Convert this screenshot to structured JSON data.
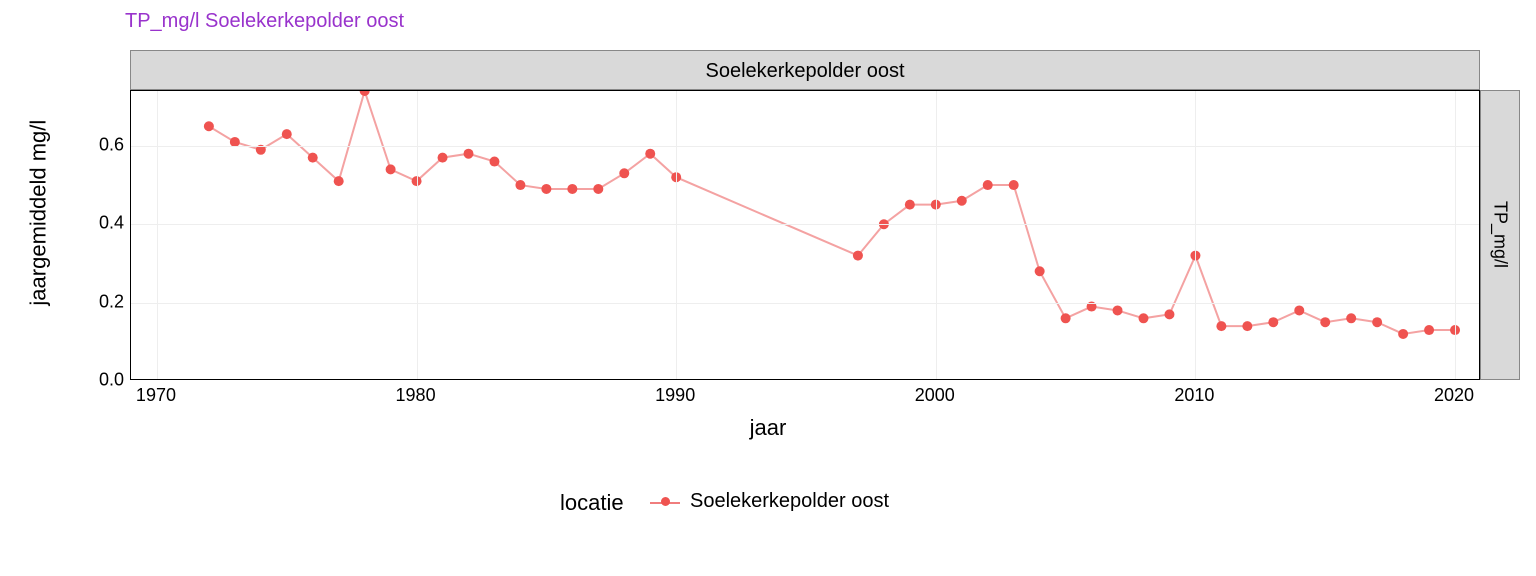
{
  "title": "TP_mg/l Soelekerkepolder oost",
  "facet_top": "Soelekerkepolder oost",
  "facet_right": "TP_mg/l",
  "xlabel": "jaar",
  "ylabel": "jaargemiddeld\nmg/l",
  "legend_title": "locatie",
  "legend_item": "Soelekerkepolder oost",
  "y_ticks": [
    0.0,
    0.2,
    0.4,
    0.6
  ],
  "x_ticks": [
    1970,
    1980,
    1990,
    2000,
    2010,
    2020
  ],
  "chart_data": {
    "type": "line",
    "title": "TP_mg/l Soelekerkepolder oost",
    "xlabel": "jaar",
    "ylabel": "jaargemiddeld mg/l",
    "xlim": [
      1969,
      2021
    ],
    "ylim": [
      0.0,
      0.74
    ],
    "series": [
      {
        "name": "Soelekerkepolder oost",
        "color": "#ef5350",
        "x": [
          1972,
          1973,
          1974,
          1975,
          1976,
          1977,
          1978,
          1979,
          1980,
          1981,
          1982,
          1983,
          1984,
          1985,
          1986,
          1987,
          1988,
          1989,
          1990,
          1997,
          1998,
          1999,
          2000,
          2001,
          2002,
          2003,
          2004,
          2005,
          2006,
          2007,
          2008,
          2009,
          2010,
          2011,
          2012,
          2013,
          2014,
          2015,
          2016,
          2017,
          2018,
          2019,
          2020
        ],
        "y": [
          0.65,
          0.61,
          0.59,
          0.63,
          0.57,
          0.51,
          0.74,
          0.54,
          0.51,
          0.57,
          0.58,
          0.56,
          0.5,
          0.49,
          0.49,
          0.49,
          0.53,
          0.58,
          0.52,
          0.32,
          0.4,
          0.45,
          0.45,
          0.46,
          0.5,
          0.5,
          0.28,
          0.16,
          0.19,
          0.18,
          0.16,
          0.17,
          0.32,
          0.14,
          0.14,
          0.15,
          0.18,
          0.15,
          0.16,
          0.15,
          0.12,
          0.13,
          0.13
        ]
      }
    ]
  }
}
